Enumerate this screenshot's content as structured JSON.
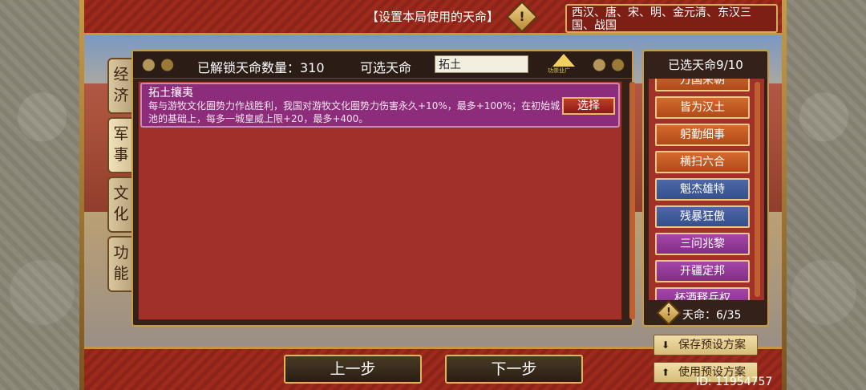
{
  "header": {
    "title": "【设置本局使用的天命】",
    "dynasties": "西汉、唐、宋、明、金元清、东汉三国、战国"
  },
  "tabs": [
    {
      "label": "经济"
    },
    {
      "label": "军事"
    },
    {
      "label": "文化"
    },
    {
      "label": "功能"
    }
  ],
  "main": {
    "unlocked_label": "已解锁天命数量：310",
    "available_label": "可选天命",
    "search_value": "拓土",
    "wealth_icon_caption": "功崇业广",
    "items": [
      {
        "title": "拓土攘夷",
        "description": "每与游牧文化圈势力作战胜利，我国对游牧文化圈势力伤害永久+10%，最多+100%；在初始城池的基础上，每多一城皇威上限+20，最多+400。",
        "button": "选择"
      }
    ]
  },
  "selected": {
    "title": "已选天命9/10",
    "items": [
      {
        "label": "万国来朝",
        "color": "orange"
      },
      {
        "label": "皆为汉土",
        "color": "orange"
      },
      {
        "label": "躬勤细事",
        "color": "orange"
      },
      {
        "label": "横扫六合",
        "color": "orange"
      },
      {
        "label": "魁杰雄特",
        "color": "blue"
      },
      {
        "label": "残暴狂傲",
        "color": "blue"
      },
      {
        "label": "三问兆黎",
        "color": "purple"
      },
      {
        "label": "开疆定邦",
        "color": "purple"
      },
      {
        "label": "杯酒释兵权",
        "color": "purple"
      }
    ],
    "count_label": "天命：6/35"
  },
  "footer": {
    "prev_label": "上一步",
    "next_label": "下一步",
    "save_preset_label": "保存预设方案",
    "use_preset_label": "使用预设方案",
    "id_label": "ID: 11954757"
  },
  "colors": {
    "accent_gold": "#c79a48",
    "panel_dark": "#33211a",
    "list_red": "#a13128",
    "item_purple": "#8c2c7a"
  }
}
